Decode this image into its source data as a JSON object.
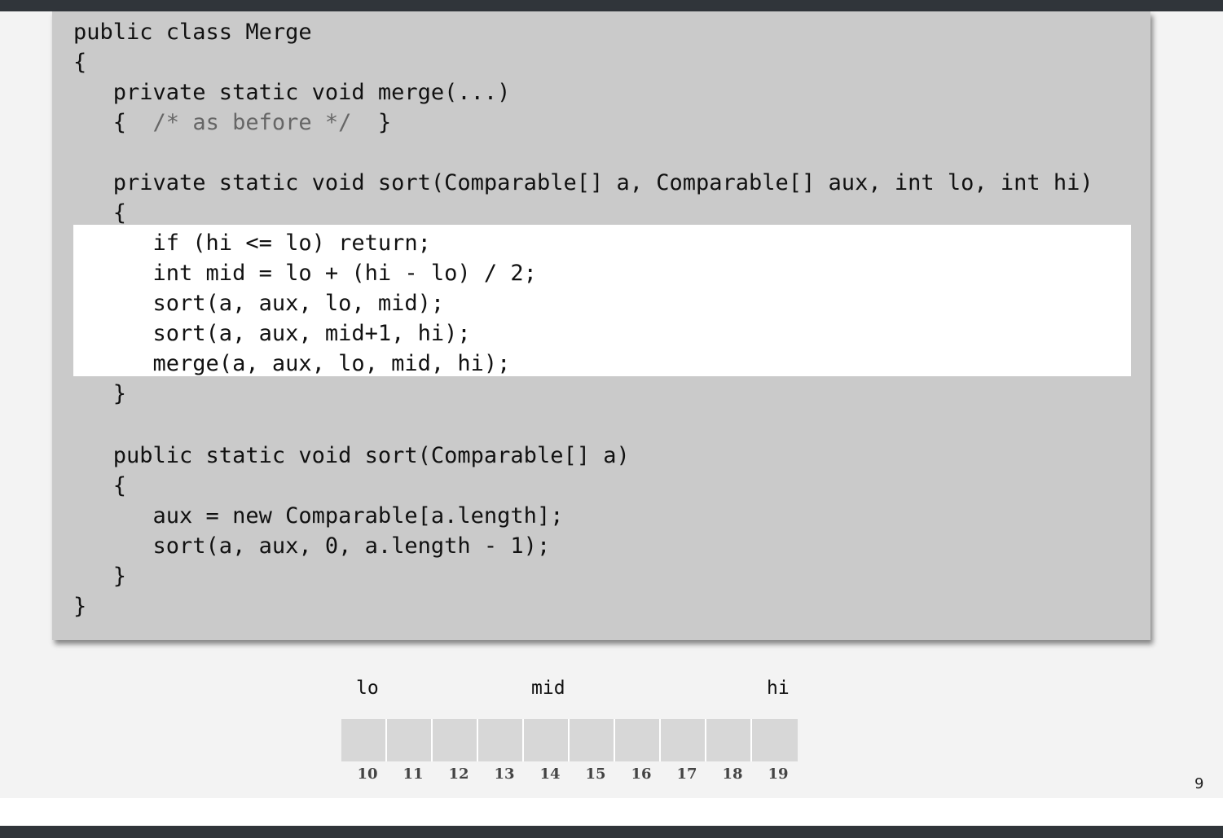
{
  "code": {
    "lines": [
      "public class Merge",
      "{",
      "   private static void merge(...)",
      "   {  ",
      "",
      "   private static void sort(Comparable[] a, Comparable[] aux, int lo, int hi)",
      "   {",
      "      if (hi <= lo) return;",
      "      int mid = lo + (hi - lo) / 2;",
      "      sort(a, aux, lo, mid);",
      "      sort(a, aux, mid+1, hi);",
      "      merge(a, aux, lo, mid, hi);",
      "   }",
      "",
      "   public static void sort(Comparable[] a)",
      "   {",
      "      aux = new Comparable[a.length];",
      "      sort(a, aux, 0, a.length - 1);",
      "   }",
      "}"
    ],
    "comment": "/* as before */",
    "comment_tail": "  }"
  },
  "array": {
    "lo_label": "lo",
    "mid_label": "mid",
    "hi_label": "hi",
    "indices": [
      "10",
      "11",
      "12",
      "13",
      "14",
      "15",
      "16",
      "17",
      "18",
      "19"
    ]
  },
  "page_number": "9"
}
